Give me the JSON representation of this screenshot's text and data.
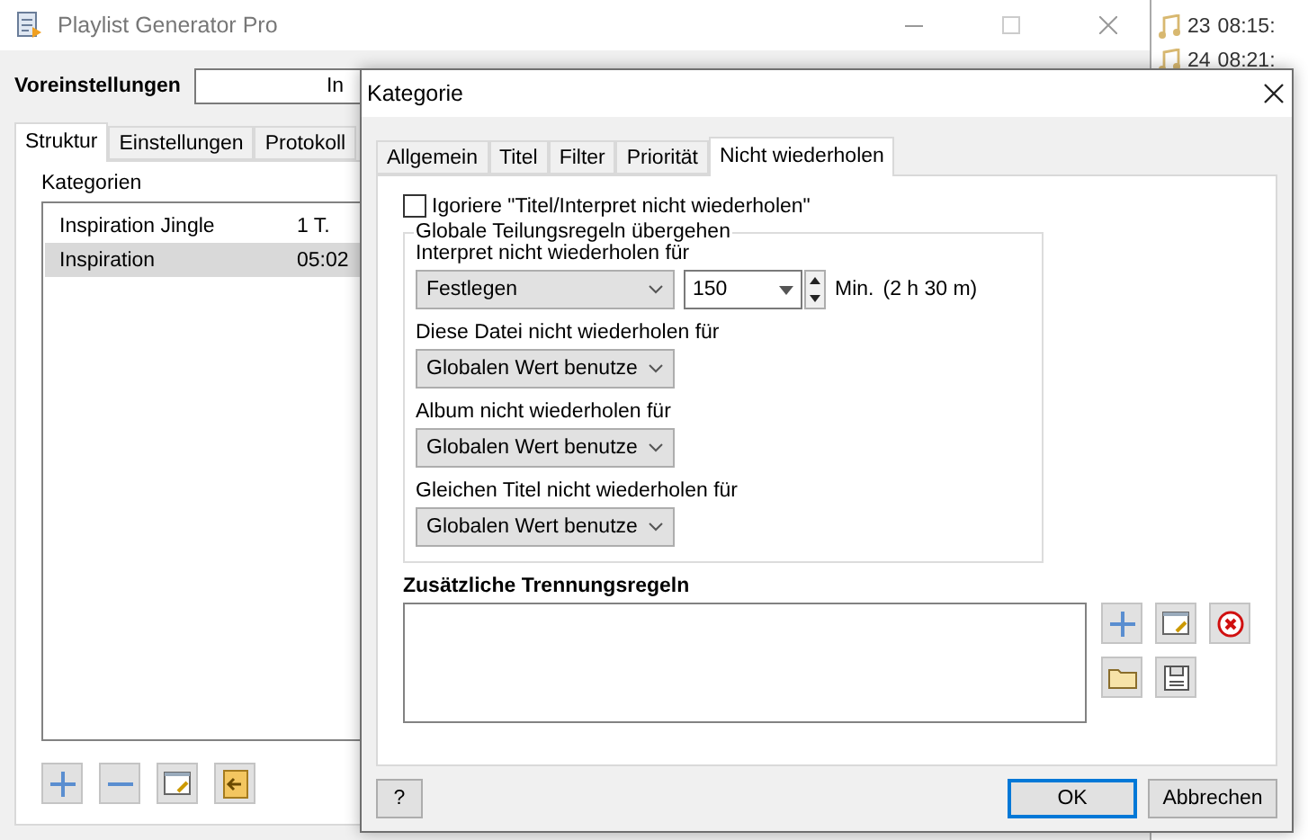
{
  "main_window": {
    "title": "Playlist Generator Pro",
    "preset_label": "Voreinstellungen",
    "preset_value": "In",
    "tabs": [
      {
        "label": "Struktur",
        "selected": true
      },
      {
        "label": "Einstellungen",
        "selected": false
      },
      {
        "label": "Protokoll",
        "selected": false
      }
    ],
    "categories_label": "Kategorien",
    "categories": [
      {
        "name": "Inspiration Jingle",
        "value": "1 T.",
        "selected": false
      },
      {
        "name": "Inspiration",
        "value": "05:02",
        "selected": true
      }
    ]
  },
  "side_list": [
    {
      "number": "23",
      "time": "08:15:"
    },
    {
      "number": "24",
      "time": "08:21:"
    }
  ],
  "dialog": {
    "title": "Kategorie",
    "tabs": [
      {
        "label": "Allgemein",
        "selected": false
      },
      {
        "label": "Titel",
        "selected": false
      },
      {
        "label": "Filter",
        "selected": false
      },
      {
        "label": "Priorität",
        "selected": false
      },
      {
        "label": "Nicht wiederholen",
        "selected": true
      }
    ],
    "ignore_checkbox": {
      "label": "Igoriere \"Titel/Interpret nicht wiederholen\"",
      "checked": false
    },
    "group_title": "Globale Teilungsregeln übergehen",
    "rules": [
      {
        "label": "Interpret nicht wiederholen für",
        "value": "Festlegen",
        "minutes": "150",
        "unit": "Min.",
        "duration": "(2 h 30 m)"
      },
      {
        "label": "Diese Datei nicht wiederholen für",
        "value": "Globalen Wert benutze"
      },
      {
        "label": "Album nicht wiederholen für",
        "value": "Globalen Wert benutze"
      },
      {
        "label": "Gleichen Titel nicht wiederholen für",
        "value": "Globalen Wert benutze"
      }
    ],
    "extra_rules_label": "Zusätzliche Trennungsregeln",
    "help_button": "?",
    "ok_button": "OK",
    "cancel_button": "Abbrechen"
  }
}
